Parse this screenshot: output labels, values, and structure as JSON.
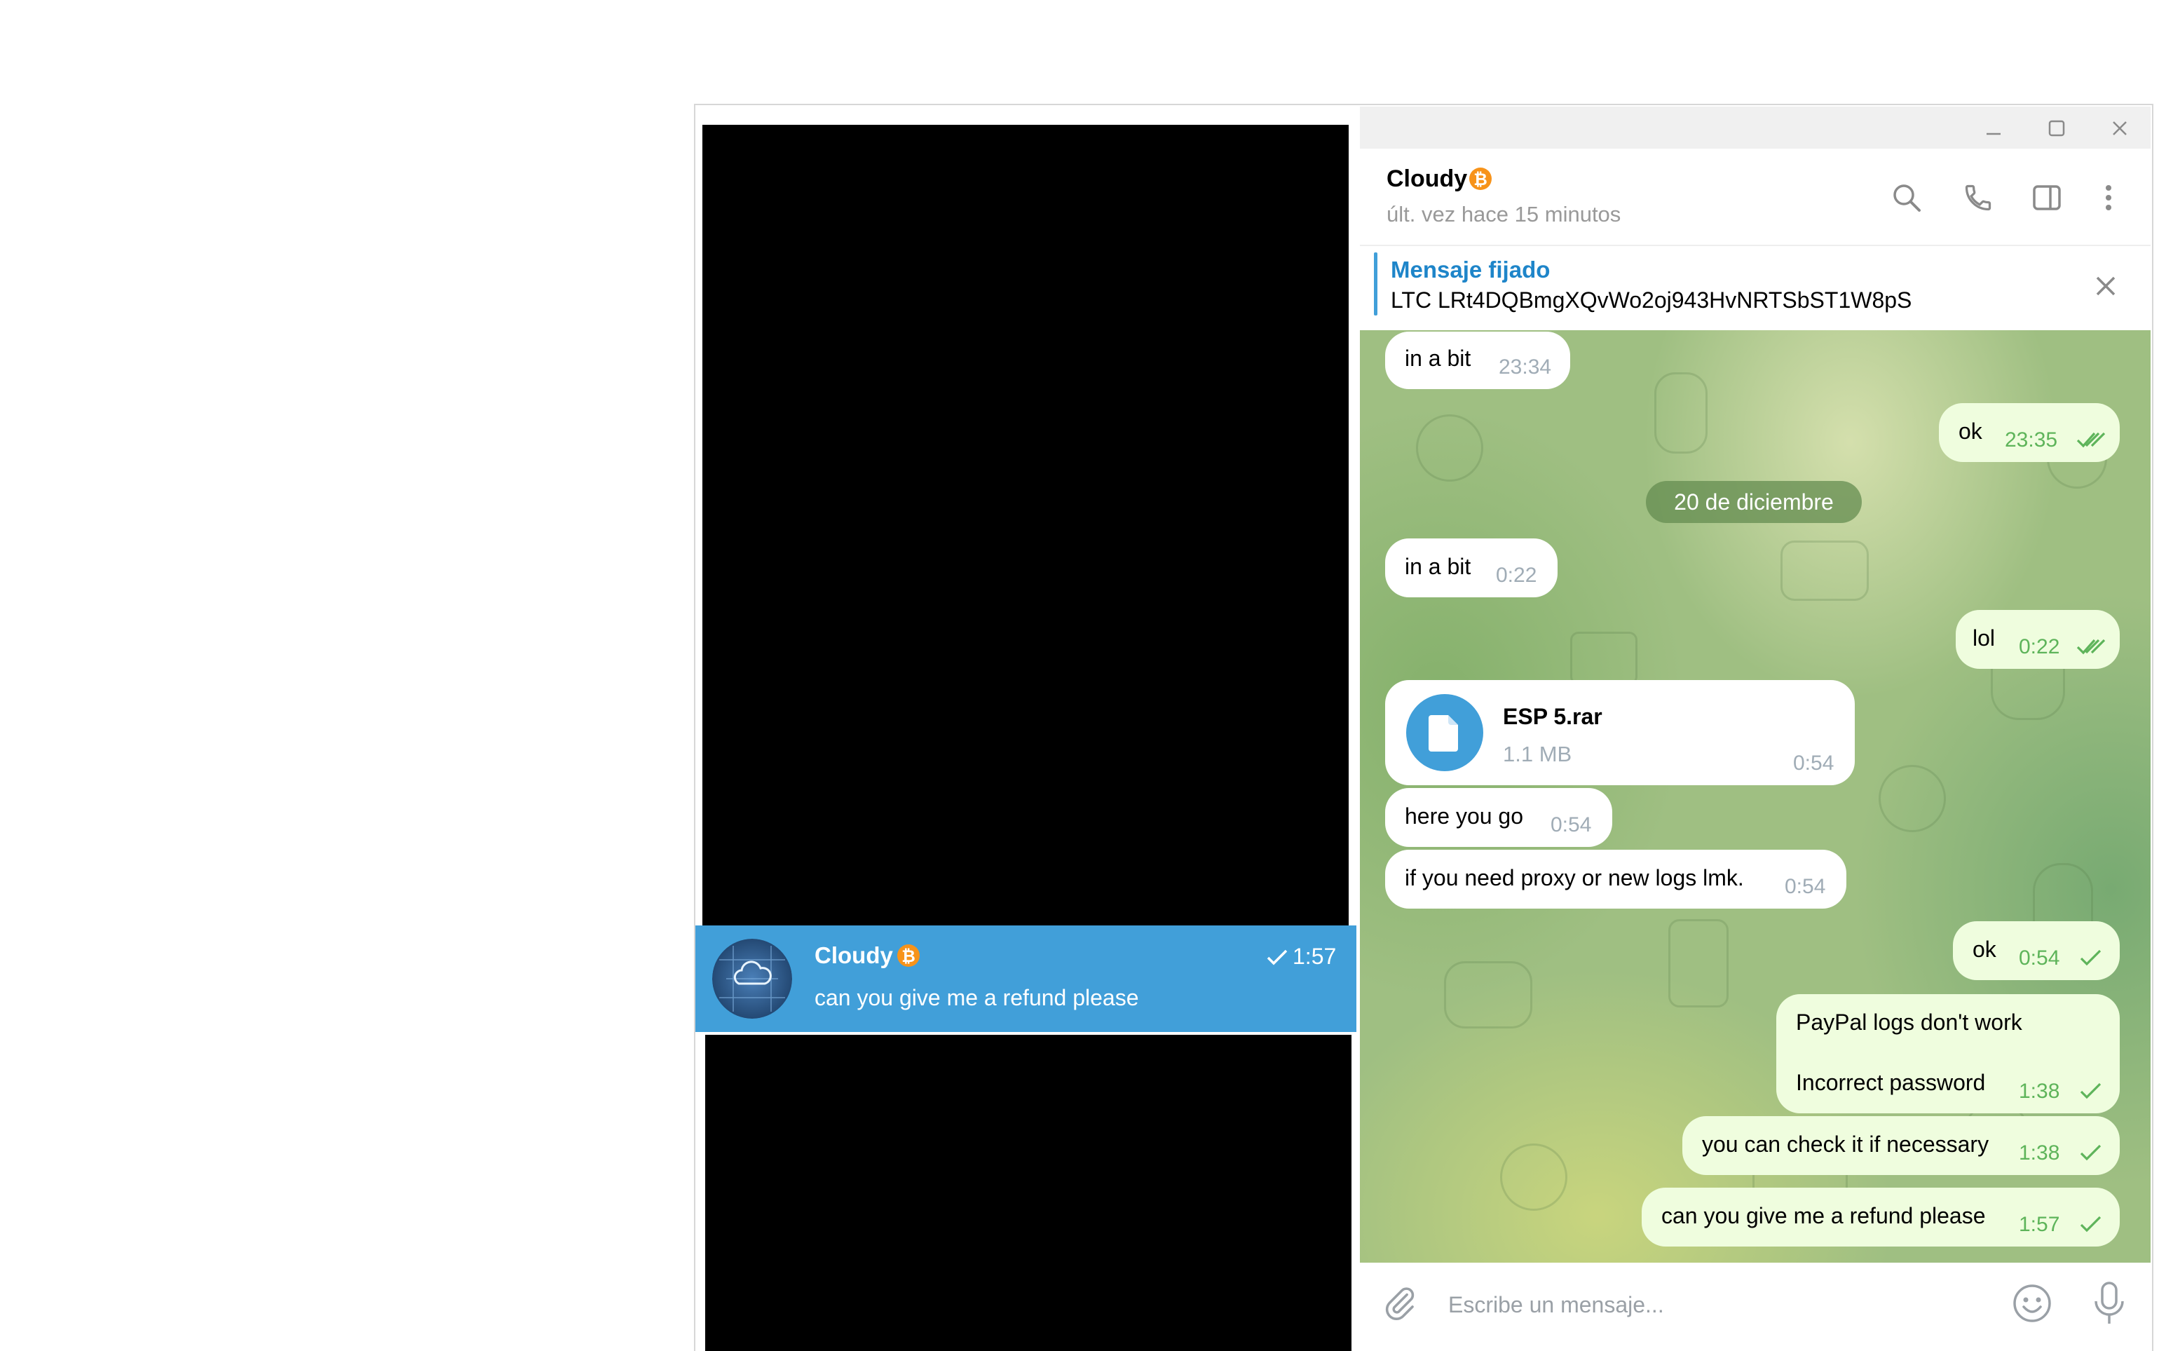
{
  "colors": {
    "accent": "#419fd9",
    "outgoing_bubble": "#effdde",
    "incoming_bubble": "#ffffff",
    "read_check": "#5eb45a"
  },
  "window": {
    "minimize_icon": "minimize-icon",
    "maximize_icon": "maximize-icon",
    "close_icon": "close-icon"
  },
  "chat_list": {
    "selected": {
      "name": "Cloudy",
      "name_badge": "bitcoin-emoji",
      "time": "1:57",
      "status_icon": "check-icon",
      "last_message": "can you give me a refund please"
    }
  },
  "header": {
    "name": "Cloudy",
    "badge": "bitcoin-emoji",
    "status": "últ. vez hace 15 minutos",
    "icons": [
      "search-icon",
      "phone-icon",
      "sidebar-toggle-icon",
      "more-vertical-icon"
    ]
  },
  "pinned": {
    "title": "Mensaje fijado",
    "text": "LTC LRt4DQBmgXQvWo2oj943HvNRTSbST1W8pS"
  },
  "messages": {
    "m1": {
      "text": "in a bit",
      "time": "23:34"
    },
    "m2": {
      "text": "ok",
      "time": "23:35",
      "status": "read"
    },
    "date_separator": "20 de diciembre",
    "m3": {
      "text": "in a bit",
      "time": "0:22"
    },
    "m4": {
      "text": "lol",
      "time": "0:22",
      "status": "read"
    },
    "file": {
      "name": "ESP 5.rar",
      "size": "1.1 MB",
      "time": "0:54"
    },
    "m5": {
      "text": "here you go",
      "time": "0:54"
    },
    "m6": {
      "text": "if you need proxy or new logs lmk.",
      "time": "0:54"
    },
    "m7": {
      "text": "ok",
      "time": "0:54",
      "status": "sent"
    },
    "m8": {
      "line1": "PayPal logs don't work",
      "line2": "Incorrect password",
      "time": "1:38",
      "status": "sent"
    },
    "m9": {
      "text": "you can check it if necessary",
      "time": "1:38",
      "status": "sent"
    },
    "m10": {
      "text": "can you give me a refund please",
      "time": "1:57",
      "status": "sent"
    }
  },
  "composer": {
    "placeholder": "Escribe un mensaje...",
    "attach_icon": "paperclip-icon",
    "emoji_icon": "emoji-icon",
    "mic_icon": "microphone-icon"
  }
}
